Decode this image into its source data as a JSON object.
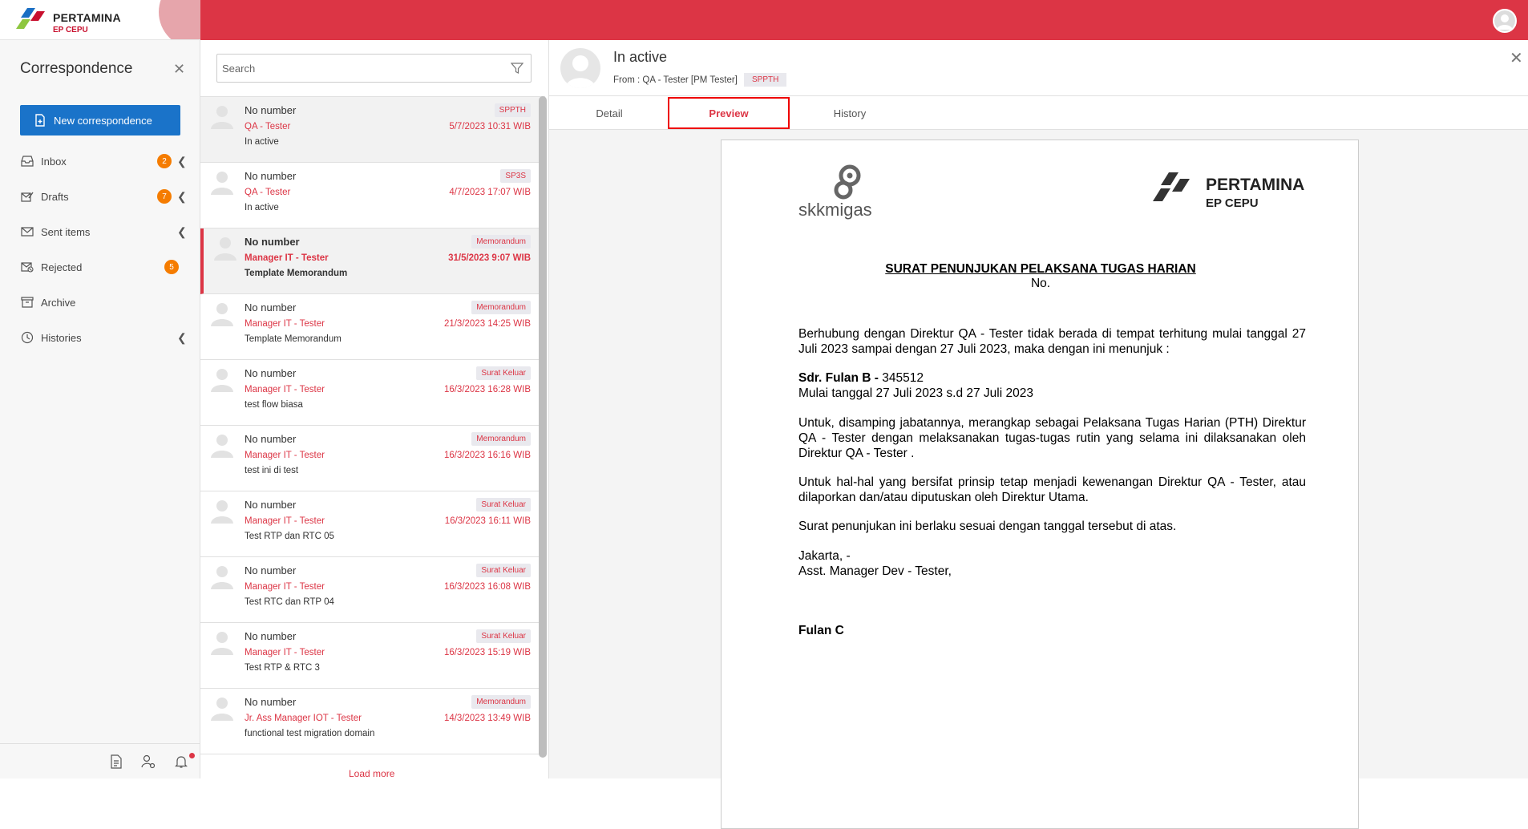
{
  "app": {
    "logo_name": "PERTAMINA",
    "logo_sub": "EP CEPU",
    "accent": "#dc3545",
    "primary": "#1a73c9"
  },
  "sidebar": {
    "title": "Correspondence",
    "new_button": "New correspondence",
    "items": [
      {
        "label": "Inbox",
        "icon": "inbox-icon",
        "badge": "2",
        "chevron": true
      },
      {
        "label": "Drafts",
        "icon": "drafts-icon",
        "badge": "7",
        "chevron": true
      },
      {
        "label": "Sent items",
        "icon": "sent-icon",
        "badge": "",
        "chevron": true
      },
      {
        "label": "Rejected",
        "icon": "rejected-icon",
        "badge": "5",
        "chevron": false
      },
      {
        "label": "Archive",
        "icon": "archive-icon",
        "badge": "",
        "chevron": false
      },
      {
        "label": "Histories",
        "icon": "history-icon",
        "badge": "",
        "chevron": true
      }
    ]
  },
  "search": {
    "placeholder": "Search"
  },
  "list": {
    "rows": [
      {
        "number": "No number",
        "sender": "QA - Tester",
        "subject": "In active",
        "tag": "SPPTH",
        "date": "5/7/2023 10:31 WIB"
      },
      {
        "number": "No number",
        "sender": "QA - Tester",
        "subject": "In active",
        "tag": "SP3S",
        "date": "4/7/2023 17:07 WIB"
      },
      {
        "number": "No number",
        "sender": "Manager IT - Tester",
        "subject": "Template Memorandum",
        "tag": "Memorandum",
        "date": "31/5/2023 9:07 WIB"
      },
      {
        "number": "No number",
        "sender": "Manager IT - Tester",
        "subject": "Template Memorandum",
        "tag": "Memorandum",
        "date": "21/3/2023 14:25 WIB"
      },
      {
        "number": "No number",
        "sender": "Manager IT - Tester",
        "subject": "test flow biasa",
        "tag": "Surat Keluar",
        "date": "16/3/2023 16:28 WIB"
      },
      {
        "number": "No number",
        "sender": "Manager IT - Tester",
        "subject": "test ini di test",
        "tag": "Memorandum",
        "date": "16/3/2023 16:16 WIB"
      },
      {
        "number": "No number",
        "sender": "Manager IT - Tester",
        "subject": "Test RTP dan RTC 05",
        "tag": "Surat Keluar",
        "date": "16/3/2023 16:11 WIB"
      },
      {
        "number": "No number",
        "sender": "Manager IT - Tester",
        "subject": "Test RTC dan RTP 04",
        "tag": "Surat Keluar",
        "date": "16/3/2023 16:08 WIB"
      },
      {
        "number": "No number",
        "sender": "Manager IT - Tester",
        "subject": "Test RTP & RTC 3",
        "tag": "Surat Keluar",
        "date": "16/3/2023 15:19 WIB"
      },
      {
        "number": "No number",
        "sender": "Jr. Ass Manager IOT - Tester",
        "subject": "functional test migration domain",
        "tag": "Memorandum",
        "date": "14/3/2023 13:49 WIB"
      }
    ],
    "load_more": "Load more"
  },
  "detail": {
    "title": "In active",
    "from": "From : QA - Tester [PM Tester]",
    "tag": "SPPTH",
    "tabs": [
      "Detail",
      "Preview",
      "History"
    ],
    "selected_tab": "Preview"
  },
  "document": {
    "logo_left": "skkmigas",
    "logo_right": "PERTAMINA",
    "logo_right_sub": "EP CEPU",
    "heading": "SURAT PENUNJUKAN PELAKSANA TUGAS HARIAN",
    "number": "No.",
    "para1": "Berhubung dengan Direktur QA - Tester tidak berada di tempat terhitung mulai tanggal 27 Juli 2023 sampai dengan 27 Juli 2023, maka dengan ini menunjuk :",
    "appointee_name": "Sdr. Fulan B -",
    "appointee_id": " 345512",
    "period": "Mulai tanggal 27 Juli 2023 s.d 27 Juli 2023",
    "para2": "Untuk, disamping jabatannya, merangkap sebagai Pelaksana Tugas Harian (PTH) Direktur QA - Tester dengan melaksanakan tugas-tugas rutin yang selama ini dilaksanakan oleh Direktur QA - Tester .",
    "para3": "Untuk hal-hal yang bersifat prinsip tetap menjadi kewenangan Direktur QA - Tester, atau dilaporkan dan/atau diputuskan oleh Direktur Utama.",
    "para4": "Surat penunjukan  ini berlaku sesuai dengan tanggal tersebut di atas.",
    "place": "Jakarta, -",
    "signer_title": "Asst. Manager Dev - Tester,",
    "signer_name": "Fulan C"
  }
}
